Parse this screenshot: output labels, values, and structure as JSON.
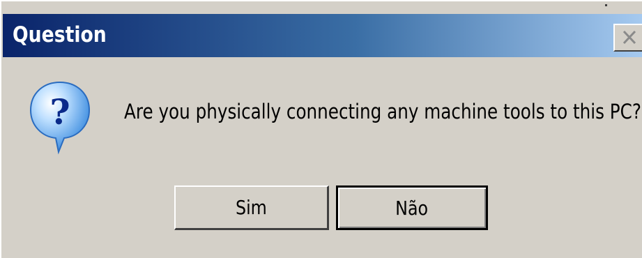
{
  "window": {
    "title": "Question",
    "close_icon": "close-icon"
  },
  "dialog": {
    "icon": "question-icon",
    "message": "Are you physically connecting any machine tools to this PC?"
  },
  "buttons": {
    "yes_label": "Sim",
    "no_label": "Não"
  },
  "colors": {
    "titlebar_start": "#0a246a",
    "titlebar_end": "#a6caf0",
    "face": "#d4d0c8",
    "icon_bubble": "#5aa0e8"
  }
}
